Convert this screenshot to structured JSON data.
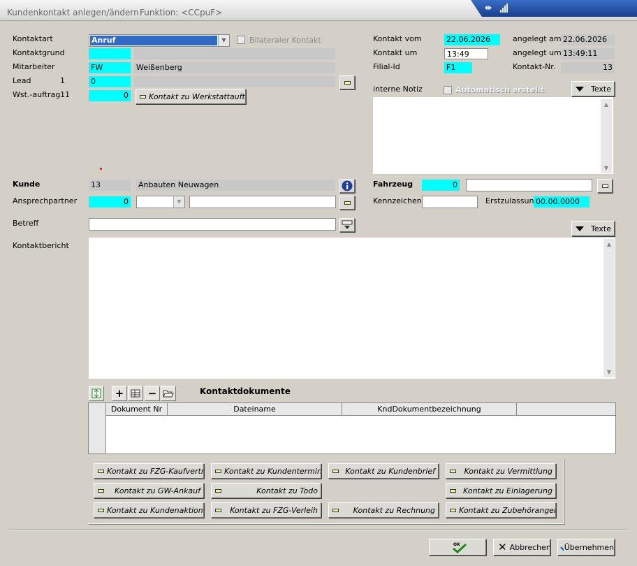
{
  "window": {
    "title": "Kundenkontakt anlegen/ändern",
    "funktion": "Funktion: <CCpuF>"
  },
  "left": {
    "kontaktart_label": "Kontaktart",
    "kontaktart_value": "Anruf",
    "bilateral_label": "Bilateraler Kontakt",
    "kontaktgrund_label": "Kontaktgrund",
    "kontaktgrund_code": "",
    "kontaktgrund_text": "",
    "mitarbeiter_label": "Mitarbeiter",
    "mitarbeiter_code": "FW",
    "mitarbeiter_name": "Weißenberg",
    "lead_label": "Lead",
    "lead_count": "1",
    "lead_value": "0",
    "wst_label": "Wst.-auftrag",
    "wst_count": "11",
    "wst_value": "0",
    "wst_button": "Kontakt zu Werkstattauftrag"
  },
  "right": {
    "kontakt_vom_label": "Kontakt vom",
    "kontakt_vom_value": "22.06.2026",
    "angelegt_am_label": "angelegt am",
    "angelegt_am_value": "22.06.2026",
    "kontakt_um_label": "Kontakt um",
    "kontakt_um_value": "13:49",
    "angelegt_um_label": "angelegt um",
    "angelegt_um_value": "13:49:11",
    "filial_label": "Filial-Id",
    "filial_value": "F1",
    "kontakt_nr_label": "Kontakt-Nr.",
    "kontakt_nr_value": "13",
    "interne_notiz_label": "interne Notiz",
    "automatisch_label": "Automatisch erstellt",
    "texte_label": "Texte"
  },
  "kunde": {
    "label": "Kunde",
    "nr": "13",
    "name": "Anbauten Neuwagen",
    "ansprech_label": "Ansprechpartner",
    "ansprech_value": "0",
    "betreff_label": "Betreff",
    "betreff_value": ""
  },
  "fahrzeug": {
    "label": "Fahrzeug",
    "value": "0",
    "kennzeichen_label": "Kennzeichen",
    "kennzeichen_value": "",
    "erstzulassung_label": "Erstzulassung",
    "erstzulassung_value": "00.00.0000"
  },
  "bericht": {
    "label": "Kontaktbericht",
    "texte_label": "Texte"
  },
  "dokumente": {
    "title": "Kontaktdokumente",
    "columns": [
      "Dokument Nr",
      "Dateiname",
      "KndDokumentbezeichnung"
    ]
  },
  "link_buttons": [
    "Kontakt zu FZG-Kaufvertrag",
    "Kontakt zu Kundentermin",
    "Kontakt zu Kundenbrief",
    "Kontakt zu Vermittlung",
    "Kontakt zu GW-Ankauf",
    "Kontakt zu Todo",
    "",
    "Kontakt zu Einlagerung",
    "Kontakt zu Kundenaktion",
    "Kontakt zu FZG-Verleih",
    "Kontakt zu Rechnung",
    "Kontakt zu Zubehörangebot"
  ],
  "footer": {
    "ok_label": "OK",
    "abbrechen_label": "Abbrechen",
    "uebernehmen_label": "Übernehmen"
  }
}
